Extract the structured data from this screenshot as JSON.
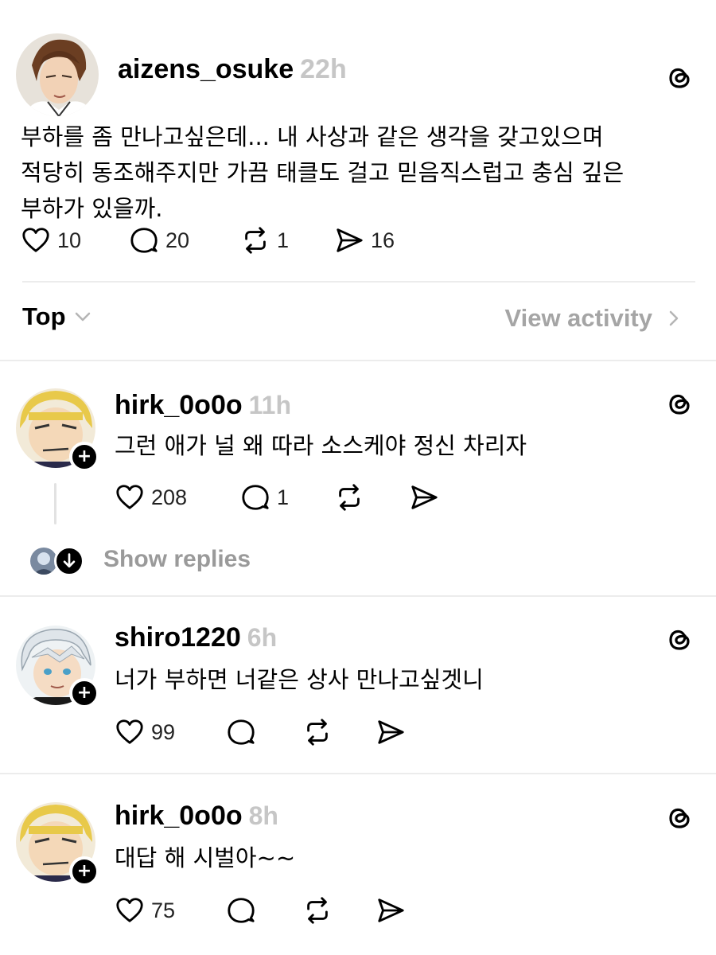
{
  "post": {
    "username": "aizens_osuke",
    "time": "22h",
    "lines": [
      "부하를 좀 만나고싶은데... 내 사상과 같은 생각을 갖고있으며",
      "적당히 동조해주지만 가끔 태클도 걸고 믿음직스럽고 충심 깊은",
      "부하가 있을까."
    ],
    "likes": "10",
    "comments": "20",
    "reposts": "1",
    "shares": "16"
  },
  "sort": {
    "label": "Top",
    "view_activity": "View activity"
  },
  "replies": [
    {
      "username": "hirk_0o0o",
      "time": "11h",
      "text": "그런 애가 널 왜 따라 소스케야 정신 차리자",
      "likes": "208",
      "comments": "1",
      "show_replies": "Show replies"
    },
    {
      "username": "shiro1220",
      "time": "6h",
      "text": "너가 부하면 너같은 상사 만나고싶겟니",
      "likes": "99"
    },
    {
      "username": "hirk_0o0o",
      "time": "8h",
      "text": "대답 해 시벌아~~",
      "likes": "75"
    }
  ],
  "icons": {
    "like": "heart-icon",
    "comment": "comment-bubble-icon",
    "repost": "repost-icon",
    "share": "send-icon",
    "threads": "threads-logo-icon",
    "follow": "plus-icon"
  }
}
